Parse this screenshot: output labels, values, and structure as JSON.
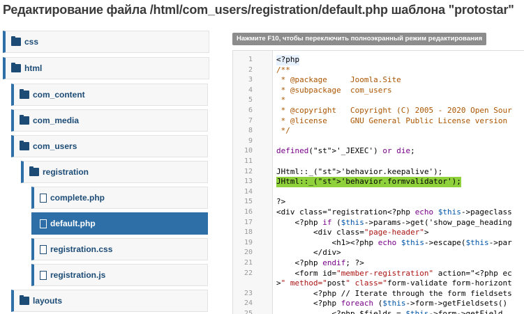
{
  "page_title": "Редактирование файла /html/com_users/registration/default.php шаблона \"protostar\"",
  "editor_hint": "Нажмите F10, чтобы переключить полноэкранный режим редактирования",
  "tree": [
    {
      "label": "css",
      "type": "folder"
    },
    {
      "label": "html",
      "type": "folder"
    },
    {
      "label": "com_content",
      "type": "folder"
    },
    {
      "label": "com_media",
      "type": "folder"
    },
    {
      "label": "com_users",
      "type": "folder"
    },
    {
      "label": "registration",
      "type": "folder"
    },
    {
      "label": "complete.php",
      "type": "file"
    },
    {
      "label": "default.php",
      "type": "file",
      "active": true
    },
    {
      "label": "registration.css",
      "type": "file"
    },
    {
      "label": "registration.js",
      "type": "file"
    },
    {
      "label": "layouts",
      "type": "folder"
    }
  ],
  "code_lines": [
    {
      "n": "1",
      "t": "<?php"
    },
    {
      "n": "2",
      "t": "/**"
    },
    {
      "n": "3",
      "t": " * @package     Joomla.Site"
    },
    {
      "n": "4",
      "t": " * @subpackage  com_users"
    },
    {
      "n": "5",
      "t": " *"
    },
    {
      "n": "6",
      "t": " * @copyright   Copyright (C) 2005 - 2020 Open Sour"
    },
    {
      "n": "7",
      "t": " * @license     GNU General Public License version"
    },
    {
      "n": "8",
      "t": " */"
    },
    {
      "n": "9",
      "t": ""
    },
    {
      "n": "10",
      "t": "defined('_JEXEC') or die;"
    },
    {
      "n": "11",
      "t": ""
    },
    {
      "n": "12",
      "t": "JHtml::_('behavior.keepalive');"
    },
    {
      "n": "13",
      "t": "JHtml::_('behavior.formvalidator');"
    },
    {
      "n": "14",
      "t": ""
    },
    {
      "n": "15",
      "t": "?>"
    },
    {
      "n": "16",
      "t": "<div class=\"registration<?php echo $this->pageclass"
    },
    {
      "n": "17",
      "t": "    <?php if ($this->params->get('show_page_heading"
    },
    {
      "n": "18",
      "t": "        <div class=\"page-header\">"
    },
    {
      "n": "19",
      "t": "            <h1><?php echo $this->escape($this->par"
    },
    {
      "n": "20",
      "t": "        </div>"
    },
    {
      "n": "21",
      "t": "    <?php endif; ?>"
    },
    {
      "n": "22",
      "t": "    <form id=\"member-registration\" action=\"<?php ec"
    },
    {
      "n": "",
      "t": ">\" method=\"post\" class=\"form-validate form-horizont"
    },
    {
      "n": "23",
      "t": "        <?php // Iterate through the form fieldsets"
    },
    {
      "n": "24",
      "t": "        <?php foreach ($this->form->getFieldsets()"
    },
    {
      "n": "25",
      "t": "            <?php $fields = $this->form->getField"
    }
  ]
}
